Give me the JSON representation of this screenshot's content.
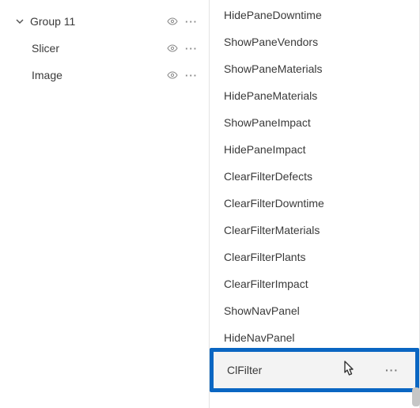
{
  "left": {
    "group": {
      "label": "Group 11"
    },
    "items": [
      {
        "label": "Slicer"
      },
      {
        "label": "Image"
      }
    ]
  },
  "right": {
    "items": [
      {
        "label": "HidePaneDowntime"
      },
      {
        "label": "ShowPaneVendors"
      },
      {
        "label": "ShowPaneMaterials"
      },
      {
        "label": "HidePaneMaterials"
      },
      {
        "label": "ShowPaneImpact"
      },
      {
        "label": "HidePaneImpact"
      },
      {
        "label": "ClearFilterDefects"
      },
      {
        "label": "ClearFilterDowntime"
      },
      {
        "label": "ClearFilterMaterials"
      },
      {
        "label": "ClearFilterPlants"
      },
      {
        "label": "ClearFilterImpact"
      },
      {
        "label": "ShowNavPanel"
      },
      {
        "label": "HideNavPanel"
      }
    ],
    "selected": {
      "label": "ClFilter"
    }
  }
}
